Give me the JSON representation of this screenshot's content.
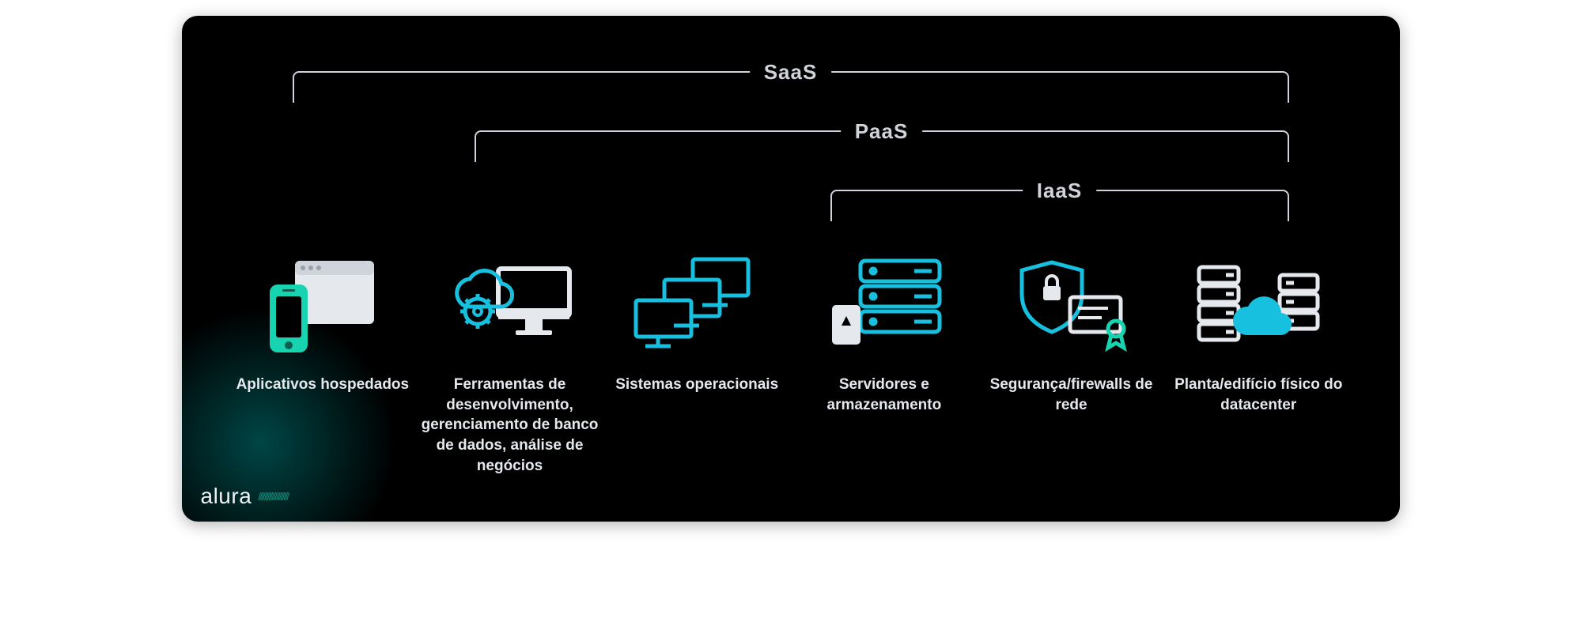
{
  "brackets": {
    "saas": "SaaS",
    "paas": "PaaS",
    "iaas": "IaaS"
  },
  "items": [
    {
      "label": "Aplicativos hospedados",
      "icon": "apps-icon"
    },
    {
      "label": "Ferramentas de desenvolvimento, gerenciamento de banco de dados, análise de negócios",
      "icon": "devtools-icon"
    },
    {
      "label": "Sistemas operacionais",
      "icon": "os-icon"
    },
    {
      "label": "Servidores e armazenamento",
      "icon": "servers-icon"
    },
    {
      "label": "Segurança/firewalls de rede",
      "icon": "security-icon"
    },
    {
      "label": "Planta/edifício físico do datacenter",
      "icon": "datacenter-icon"
    }
  ],
  "logo": {
    "text": "alura",
    "slashes": "////////////////////"
  },
  "colors": {
    "accent": "#17d3c4",
    "light": "#e5e8ed",
    "cyan": "#17c0de"
  }
}
